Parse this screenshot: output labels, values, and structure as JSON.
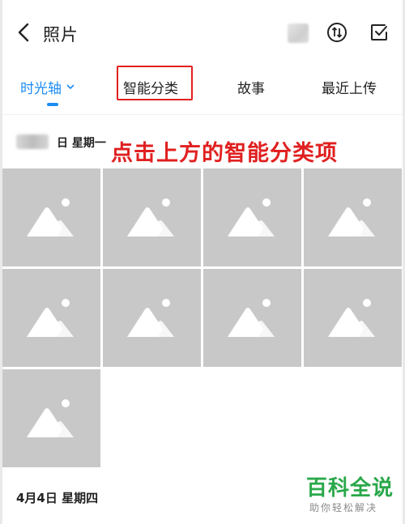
{
  "header": {
    "title": "照片",
    "icons": [
      "back-icon",
      "sort-icon",
      "select-check-icon"
    ]
  },
  "tabs": [
    {
      "label": "时光轴",
      "active": true
    },
    {
      "label": "智能分类",
      "active": false,
      "highlighted": true
    },
    {
      "label": "故事",
      "active": false
    },
    {
      "label": "最近上传",
      "active": false
    }
  ],
  "groups": [
    {
      "date": "日 星期一",
      "photo_count": 9
    },
    {
      "date": "4月4日 星期四"
    }
  ],
  "annotation": "点击上方的智能分类项",
  "watermark": {
    "title": "百科全说",
    "subtitle": "助你轻松解决"
  },
  "colors": {
    "accent": "#1b8cf2",
    "annotation": "#e02020",
    "highlight_box": "#e32020",
    "placeholder": "#c8c8c8",
    "watermark": "#2aa84a"
  }
}
